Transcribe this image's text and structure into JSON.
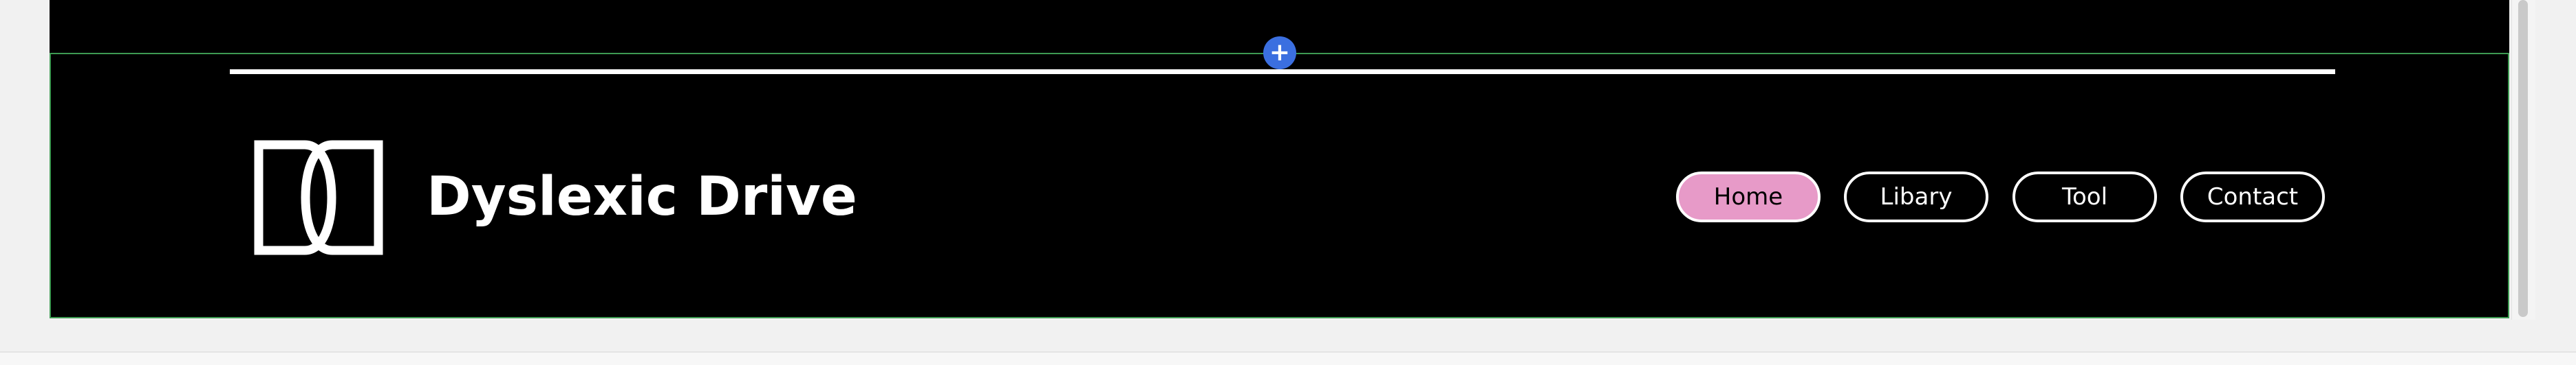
{
  "editor": {
    "add_section_icon": "plus-icon",
    "add_section_symbol": "+"
  },
  "header": {
    "brand_name": "Dyslexic Drive",
    "logo_icon": "interlocking-d-logo",
    "nav": [
      {
        "label": "Home",
        "active": true
      },
      {
        "label": "Libary",
        "active": false
      },
      {
        "label": "Tool",
        "active": false
      },
      {
        "label": "Contact",
        "active": false
      }
    ]
  },
  "colors": {
    "background": "#000000",
    "foreground": "#ffffff",
    "active_pill": "#e79ac8",
    "selection_outline": "#3d9a52",
    "add_button": "#3b6fe0"
  }
}
